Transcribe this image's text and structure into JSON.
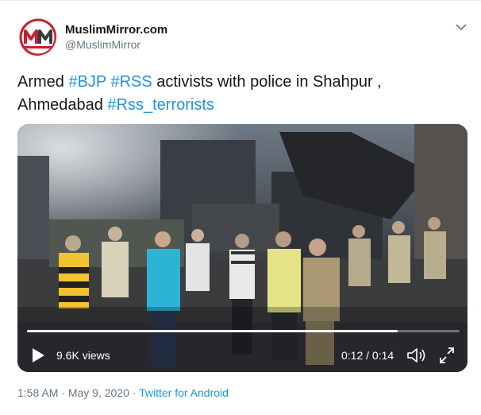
{
  "tweet": {
    "display_name": "MuslimMirror.com",
    "handle": "@MuslimMirror",
    "text": {
      "part1": "Armed ",
      "tag1": "#BJP",
      "space1": " ",
      "tag2": "#RSS",
      "part2": " activists with police in Shahpur ,",
      "part3": "Ahmedabad ",
      "tag3": "#Rss_terrorists"
    },
    "caret_icon": "chevron-down-icon"
  },
  "video": {
    "views": "9.6K views",
    "time": "0:12 / 0:14",
    "progress": 0.857,
    "icons": [
      "play-icon",
      "volume-icon",
      "fullscreen-icon"
    ]
  },
  "meta": {
    "time": "1:58 AM",
    "sep1": " · ",
    "date": "May 9, 2020",
    "sep2": " · ",
    "source": "Twitter for Android"
  },
  "colors": {
    "link": "#1b95e0",
    "secondary": "#657786",
    "logo_red": "#c8202f"
  }
}
